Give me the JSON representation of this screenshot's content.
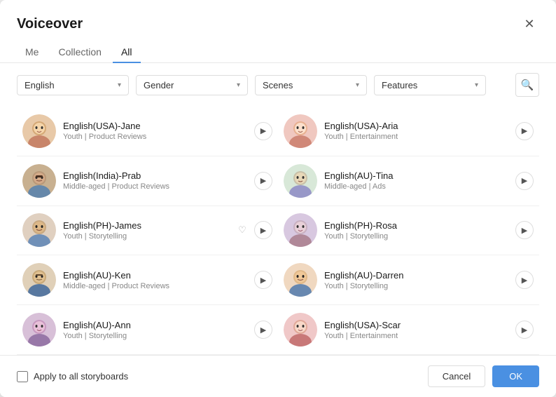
{
  "modal": {
    "title": "Voiceover",
    "close_label": "×"
  },
  "tabs": [
    {
      "id": "me",
      "label": "Me",
      "active": false
    },
    {
      "id": "collection",
      "label": "Collection",
      "active": false
    },
    {
      "id": "all",
      "label": "All",
      "active": true
    }
  ],
  "filters": {
    "language": {
      "value": "English",
      "placeholder": "English"
    },
    "gender": {
      "value": "",
      "placeholder": "Gender"
    },
    "scenes": {
      "value": "",
      "placeholder": "Scenes"
    },
    "features": {
      "value": "",
      "placeholder": "Features"
    }
  },
  "voices": [
    {
      "id": 1,
      "name": "English(USA)-Jane",
      "age": "Youth",
      "category": "Product Reviews",
      "avatar_color": "av1",
      "col": "left"
    },
    {
      "id": 2,
      "name": "English(USA)-Aria",
      "age": "Youth",
      "category": "Entertainment",
      "avatar_color": "av2",
      "col": "right"
    },
    {
      "id": 3,
      "name": "English(India)-Prab",
      "age": "Middle-aged",
      "category": "Product Reviews",
      "avatar_color": "av3",
      "col": "left"
    },
    {
      "id": 4,
      "name": "English(AU)-Tina",
      "age": "Middle-aged",
      "category": "Ads",
      "avatar_color": "av4",
      "col": "right"
    },
    {
      "id": 5,
      "name": "English(PH)-James",
      "age": "Youth",
      "category": "Storytelling",
      "avatar_color": "av5",
      "col": "left"
    },
    {
      "id": 6,
      "name": "English(PH)-Rosa",
      "age": "Youth",
      "category": "Storytelling",
      "avatar_color": "av6",
      "col": "right"
    },
    {
      "id": 7,
      "name": "English(AU)-Ken",
      "age": "Middle-aged",
      "category": "Product Reviews",
      "avatar_color": "av7",
      "col": "left"
    },
    {
      "id": 8,
      "name": "English(AU)-Darren",
      "age": "Youth",
      "category": "Storytelling",
      "avatar_color": "av8",
      "col": "right"
    },
    {
      "id": 9,
      "name": "English(AU)-Ann",
      "age": "Youth",
      "category": "Storytelling",
      "avatar_color": "av9",
      "col": "left"
    },
    {
      "id": 10,
      "name": "English(USA)-Scar",
      "age": "Youth",
      "category": "Entertainment",
      "avatar_color": "av10",
      "col": "right"
    }
  ],
  "footer": {
    "checkbox_label": "Apply to all storyboards",
    "cancel_label": "Cancel",
    "ok_label": "OK"
  }
}
